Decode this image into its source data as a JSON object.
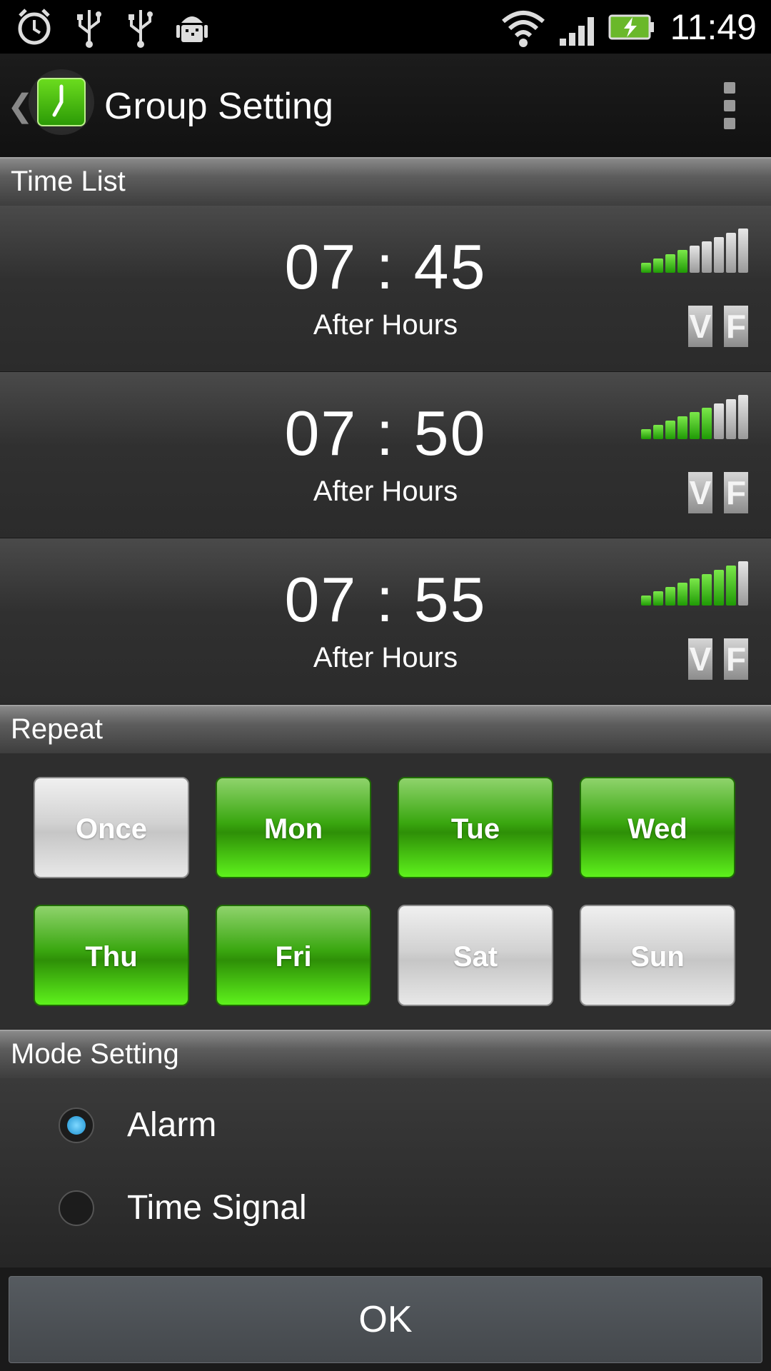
{
  "status_bar": {
    "time": "11:49",
    "icons": [
      "alarm-clock-icon",
      "usb-icon",
      "usb-icon",
      "android-debug-icon",
      "wifi-icon",
      "signal-icon",
      "battery-charging-icon"
    ]
  },
  "header": {
    "title": "Group Setting"
  },
  "sections": {
    "time_list": "Time List",
    "repeat": "Repeat",
    "mode_setting": "Mode Setting"
  },
  "time_list": [
    {
      "time": "07 : 45",
      "label": "After Hours",
      "volume_level": 4,
      "volume_max": 9,
      "v": "V",
      "f": "F"
    },
    {
      "time": "07 : 50",
      "label": "After Hours",
      "volume_level": 6,
      "volume_max": 9,
      "v": "V",
      "f": "F"
    },
    {
      "time": "07 : 55",
      "label": "After Hours",
      "volume_level": 8,
      "volume_max": 9,
      "v": "V",
      "f": "F"
    }
  ],
  "repeat_days": [
    {
      "label": "Once",
      "selected": false
    },
    {
      "label": "Mon",
      "selected": true
    },
    {
      "label": "Tue",
      "selected": true
    },
    {
      "label": "Wed",
      "selected": true
    },
    {
      "label": "Thu",
      "selected": true
    },
    {
      "label": "Fri",
      "selected": true
    },
    {
      "label": "Sat",
      "selected": false
    },
    {
      "label": "Sun",
      "selected": false
    }
  ],
  "mode": {
    "options": [
      {
        "label": "Alarm",
        "checked": true
      },
      {
        "label": "Time Signal",
        "checked": false
      }
    ]
  },
  "ok_button": "OK",
  "colors": {
    "accent_green": "#3aa710",
    "radio_blue": "#1a8fd0"
  }
}
